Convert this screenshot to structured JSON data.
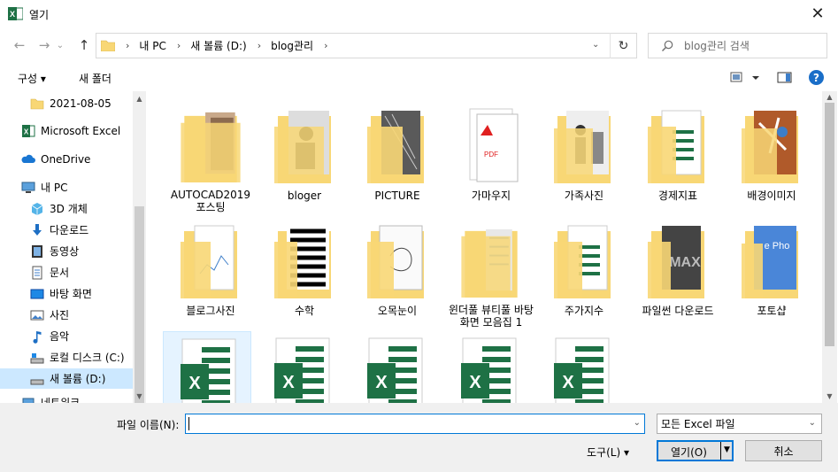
{
  "window": {
    "title": "열기",
    "close_glyph": "✕"
  },
  "nav": {
    "back_glyph": "←",
    "forward_glyph": "→",
    "recent_glyph": "⌄",
    "up_glyph": "↑",
    "breadcrumbs": [
      "내 PC",
      "새 볼륨 (D:)",
      "blog관리"
    ],
    "breadcrumb_sep": "›",
    "refresh_glyph": "↻",
    "search_placeholder": "blog관리 검색"
  },
  "toolbar": {
    "organize": "구성 ▾",
    "new_folder": "새 폴더",
    "help": "?"
  },
  "sidebar": {
    "items": [
      {
        "label": "2021-08-05",
        "icon": "folder-icon"
      },
      {
        "label": "Microsoft Excel",
        "icon": "excel-icon"
      },
      {
        "label": "OneDrive",
        "icon": "cloud-icon"
      },
      {
        "label": "내 PC",
        "icon": "pc-icon"
      },
      {
        "label": "3D 개체",
        "icon": "cube-icon"
      },
      {
        "label": "다운로드",
        "icon": "download-icon"
      },
      {
        "label": "동영상",
        "icon": "video-icon"
      },
      {
        "label": "문서",
        "icon": "document-icon"
      },
      {
        "label": "바탕 화면",
        "icon": "desktop-icon"
      },
      {
        "label": "사진",
        "icon": "picture-icon"
      },
      {
        "label": "음악",
        "icon": "music-icon"
      },
      {
        "label": "로컬 디스크 (C:)",
        "icon": "drive-icon"
      },
      {
        "label": "새 볼륨 (D:)",
        "icon": "drive-icon"
      },
      {
        "label": "네트워크",
        "icon": "network-icon"
      }
    ],
    "selected": "새 볼륨 (D:)"
  },
  "content": {
    "items": [
      {
        "name": "AUTOCAD2019 포스팅",
        "kind": "folder"
      },
      {
        "name": "bloger",
        "kind": "folder"
      },
      {
        "name": "PICTURE",
        "kind": "folder"
      },
      {
        "name": "가마우지",
        "kind": "folder"
      },
      {
        "name": "가족사진",
        "kind": "folder"
      },
      {
        "name": "경제지표",
        "kind": "folder"
      },
      {
        "name": "배경이미지",
        "kind": "folder"
      },
      {
        "name": "블로그사진",
        "kind": "folder"
      },
      {
        "name": "수학",
        "kind": "folder"
      },
      {
        "name": "오목눈이",
        "kind": "folder"
      },
      {
        "name": "윈더풀 뷰티풀 바탕화면 모음집 1",
        "kind": "folder"
      },
      {
        "name": "주가지수",
        "kind": "folder"
      },
      {
        "name": "파일썬 다운로드",
        "kind": "folder"
      },
      {
        "name": "포토샵",
        "kind": "folder"
      },
      {
        "name": "",
        "kind": "excel"
      },
      {
        "name": "",
        "kind": "excel"
      },
      {
        "name": "",
        "kind": "excel"
      },
      {
        "name": "",
        "kind": "excel"
      },
      {
        "name": "",
        "kind": "excel"
      }
    ],
    "excel_letter": "X",
    "pdf_label": "PDF",
    "max_label": "MAX",
    "photo_label": "e Pho"
  },
  "bottom": {
    "filename_label": "파일 이름(N):",
    "filename_value": "",
    "filetype": "모든 Excel 파일",
    "tools": "도구(L)   ▾",
    "open": "열기(O)",
    "cancel": "취소"
  },
  "colors": {
    "accent": "#0078d7",
    "excel": "#1e7145",
    "folder": "#f8d775",
    "select": "#cce8ff"
  }
}
